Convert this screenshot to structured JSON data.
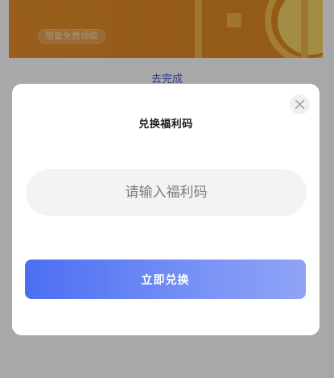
{
  "background": {
    "banner_tag": "限量免费领取",
    "link_text": "去完成"
  },
  "modal": {
    "title": "兑换福利码",
    "close_icon": "close-icon",
    "code_input": {
      "value": "",
      "placeholder": "请输入福利码"
    },
    "submit_label": "立即兑换"
  },
  "colors": {
    "banner_orange": "#e38a25",
    "link_blue": "#3d5bd8",
    "button_gradient_start": "#4c6ef3",
    "button_gradient_end": "#8fa4f7"
  }
}
